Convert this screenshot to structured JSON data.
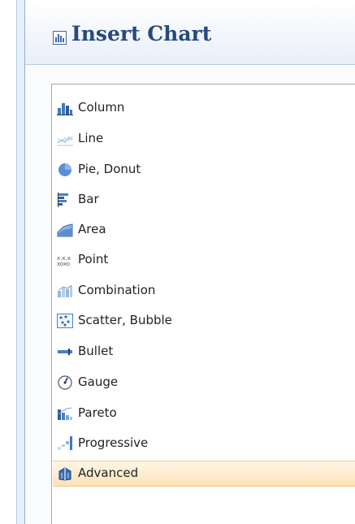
{
  "header": {
    "title": "Insert Chart",
    "icon": "chart-icon"
  },
  "chart_types": [
    {
      "label": "Column",
      "icon": "column-chart-icon"
    },
    {
      "label": "Line",
      "icon": "line-chart-icon"
    },
    {
      "label": "Pie, Donut",
      "icon": "pie-chart-icon"
    },
    {
      "label": "Bar",
      "icon": "bar-chart-icon"
    },
    {
      "label": "Area",
      "icon": "area-chart-icon"
    },
    {
      "label": "Point",
      "icon": "point-chart-icon"
    },
    {
      "label": "Combination",
      "icon": "combination-chart-icon"
    },
    {
      "label": "Scatter, Bubble",
      "icon": "scatter-chart-icon"
    },
    {
      "label": "Bullet",
      "icon": "bullet-chart-icon"
    },
    {
      "label": "Gauge",
      "icon": "gauge-chart-icon"
    },
    {
      "label": "Pareto",
      "icon": "pareto-chart-icon"
    },
    {
      "label": "Progressive",
      "icon": "progressive-chart-icon"
    },
    {
      "label": "Advanced",
      "icon": "advanced-chart-icon"
    }
  ],
  "selected": "Advanced",
  "colors": {
    "title": "#274a7d",
    "selection": "#fbe2b8",
    "icon_blue": "#4a86c8"
  }
}
